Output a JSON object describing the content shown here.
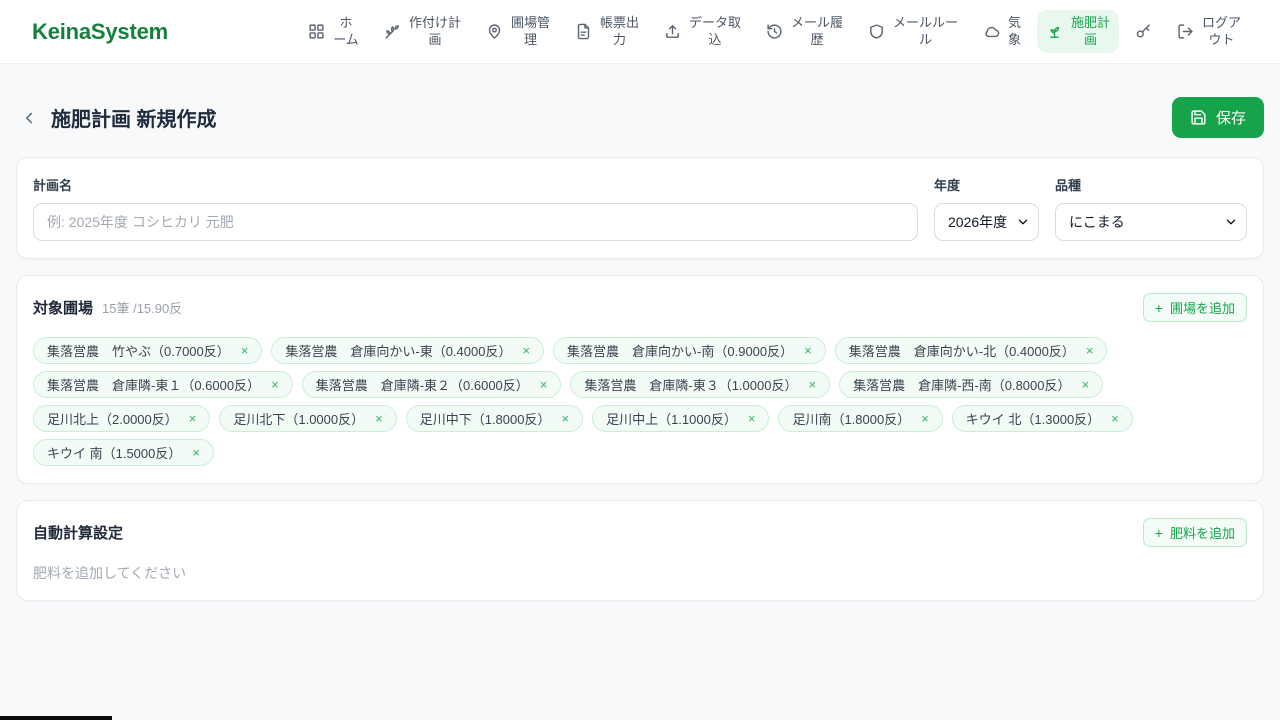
{
  "brand": "KeinaSystem",
  "nav": {
    "items": [
      {
        "label": "ホーム",
        "icon": "grid-icon"
      },
      {
        "label": "作付け計画",
        "icon": "wheat-icon"
      },
      {
        "label": "圃場管理",
        "icon": "map-pin-icon"
      },
      {
        "label": "帳票出力",
        "icon": "document-icon"
      },
      {
        "label": "データ取込",
        "icon": "upload-icon"
      },
      {
        "label": "メール履歴",
        "icon": "history-icon"
      },
      {
        "label": "メールルール",
        "icon": "shield-icon"
      },
      {
        "label": "気象",
        "icon": "cloud-icon"
      },
      {
        "label": "施肥計画",
        "icon": "sprout-icon",
        "active": true
      },
      {
        "label": "ログアウト",
        "icon": "logout-icon"
      }
    ]
  },
  "header": {
    "title": "施肥計画 新規作成",
    "save_label": "保存"
  },
  "plan_form": {
    "name_label": "計画名",
    "name_placeholder": "例: 2025年度 コシヒカリ 元肥",
    "name_value": "",
    "year_label": "年度",
    "year_value": "2026年度",
    "variety_label": "品種",
    "variety_value": "にこまる"
  },
  "fields_section": {
    "title": "対象圃場",
    "count_text": "15筆 /15.90反",
    "add_button_label": "圃場を追加",
    "tags": [
      "集落営農　竹やぶ（0.7000反）",
      "集落営農　倉庫向かい-東（0.4000反）",
      "集落営農　倉庫向かい-南（0.9000反）",
      "集落営農　倉庫向かい-北（0.4000反）",
      "集落営農　倉庫隣-東１（0.6000反）",
      "集落営農　倉庫隣-東２（0.6000反）",
      "集落営農　倉庫隣-東３（1.0000反）",
      "集落営農　倉庫隣-西-南（0.8000反）",
      "足川北上（2.0000反）",
      "足川北下（1.0000反）",
      "足川中下（1.8000反）",
      "足川中上（1.1000反）",
      "足川南（1.8000反）",
      "キウイ 北（1.3000反）",
      "キウイ 南（1.5000反）"
    ]
  },
  "auto_calc_section": {
    "title": "自動計算設定",
    "add_button_label": "肥料を追加",
    "empty_text": "肥料を追加してください"
  },
  "icons": {
    "plus": "+",
    "close": "×"
  },
  "colors": {
    "accent_green": "#16a34a",
    "brand_green": "#15803d",
    "active_nav_background": "#e9f8ef",
    "tag_background": "#f2fbf5",
    "tag_border": "#c9eed6",
    "page_background": "#f8f9fb"
  }
}
